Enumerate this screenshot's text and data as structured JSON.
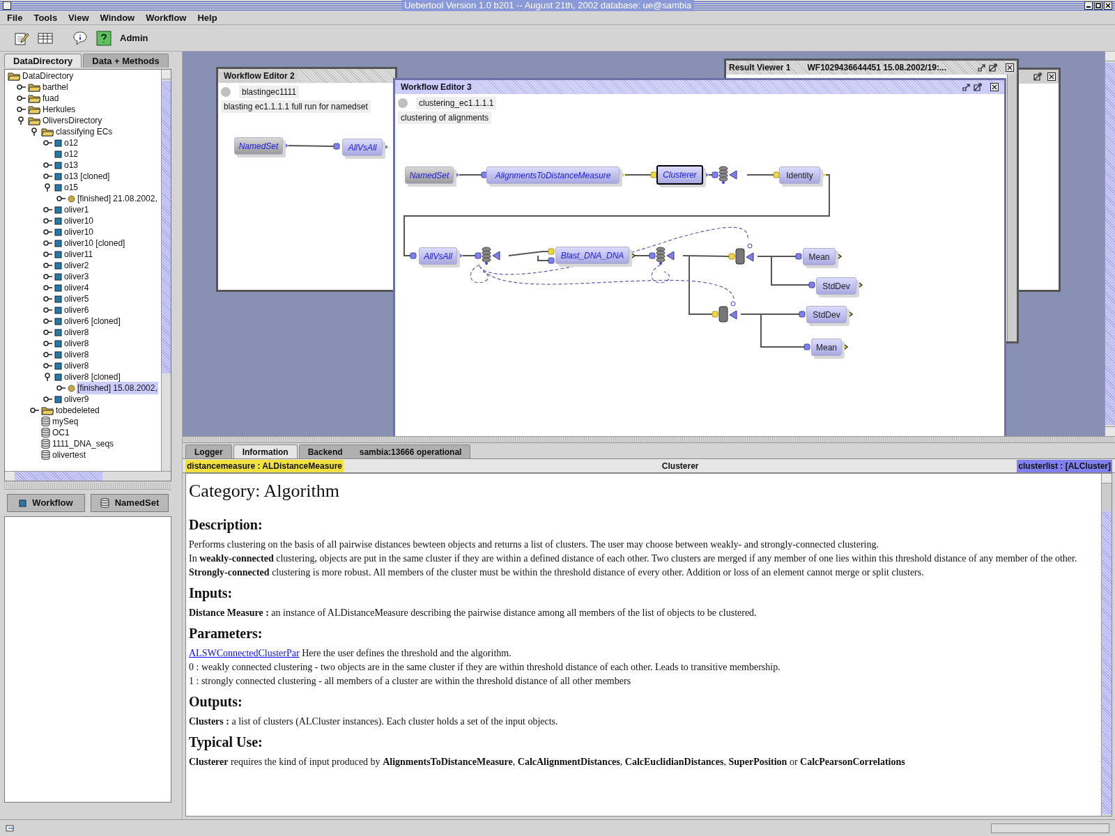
{
  "app": {
    "title": "Uebertool Version 1.0 b201 -- August 21th, 2002  database: ue@sambia",
    "menu": [
      "File",
      "Tools",
      "View",
      "Window",
      "Workflow",
      "Help"
    ],
    "toolbar": {
      "user": "Admin"
    }
  },
  "left_panel": {
    "tabs": [
      {
        "label": "DataDirectory",
        "selected": true
      },
      {
        "label": "Data + Methods",
        "selected": false
      }
    ],
    "tree": [
      {
        "label": "DataDirectory",
        "kind": "folder",
        "selected": false,
        "children": [
          {
            "label": "barthel",
            "kind": "folder",
            "expanded": false,
            "selected": false
          },
          {
            "label": "fuad",
            "kind": "folder",
            "expanded": false,
            "selected": false
          },
          {
            "label": "Herkules",
            "kind": "folder",
            "expanded": false,
            "selected": false
          },
          {
            "label": "OliversDirectory",
            "kind": "folder",
            "expanded": true,
            "selected": false,
            "children": [
              {
                "label": "classifying ECs",
                "kind": "folder",
                "expanded": true,
                "selected": false,
                "children": [
                  {
                    "label": "o12",
                    "kind": "workflow",
                    "expanded": false,
                    "selected": false
                  },
                  {
                    "label": "o12",
                    "kind": "workflow",
                    "selected": false
                  },
                  {
                    "label": "o13",
                    "kind": "workflow",
                    "expanded": false,
                    "selected": false
                  },
                  {
                    "label": "o13 [cloned]",
                    "kind": "workflow",
                    "expanded": false,
                    "selected": false
                  },
                  {
                    "label": "o15",
                    "kind": "workflow",
                    "expanded": true,
                    "selected": false,
                    "children": [
                      {
                        "label": "[finished] 21.08.2002,",
                        "kind": "result",
                        "expanded": false,
                        "selected": false
                      }
                    ]
                  },
                  {
                    "label": "oliver1",
                    "kind": "workflow",
                    "expanded": false,
                    "selected": false
                  },
                  {
                    "label": "oliver10",
                    "kind": "workflow",
                    "expanded": false,
                    "selected": false
                  },
                  {
                    "label": "oliver10",
                    "kind": "workflow",
                    "expanded": false,
                    "selected": false
                  },
                  {
                    "label": "oliver10 [cloned]",
                    "kind": "workflow",
                    "expanded": false,
                    "selected": false
                  },
                  {
                    "label": "oliver11",
                    "kind": "workflow",
                    "expanded": false,
                    "selected": false
                  },
                  {
                    "label": "oliver2",
                    "kind": "workflow",
                    "expanded": false,
                    "selected": false
                  },
                  {
                    "label": "oliver3",
                    "kind": "workflow",
                    "expanded": false,
                    "selected": false
                  },
                  {
                    "label": "oliver4",
                    "kind": "workflow",
                    "expanded": false,
                    "selected": false
                  },
                  {
                    "label": "oliver5",
                    "kind": "workflow",
                    "expanded": false,
                    "selected": false
                  },
                  {
                    "label": "oliver6",
                    "kind": "workflow",
                    "expanded": false,
                    "selected": false
                  },
                  {
                    "label": "oliver6 [cloned]",
                    "kind": "workflow",
                    "expanded": false,
                    "selected": false
                  },
                  {
                    "label": "oliver8",
                    "kind": "workflow",
                    "expanded": false,
                    "selected": false
                  },
                  {
                    "label": "oliver8",
                    "kind": "workflow",
                    "expanded": false,
                    "selected": false
                  },
                  {
                    "label": "oliver8",
                    "kind": "workflow",
                    "expanded": false,
                    "selected": false
                  },
                  {
                    "label": "oliver8",
                    "kind": "workflow",
                    "expanded": false,
                    "selected": false
                  },
                  {
                    "label": "oliver8 [cloned]",
                    "kind": "workflow",
                    "expanded": true,
                    "selected": false,
                    "children": [
                      {
                        "label": "[finished] 15.08.2002,",
                        "kind": "result",
                        "expanded": false,
                        "selected": true
                      }
                    ]
                  },
                  {
                    "label": "oliver9",
                    "kind": "workflow",
                    "expanded": false,
                    "selected": false
                  }
                ]
              },
              {
                "label": "tobedeleted",
                "kind": "folder",
                "expanded": false,
                "selected": false
              },
              {
                "label": "mySeq",
                "kind": "dataset",
                "selected": false
              },
              {
                "label": "OC1",
                "kind": "dataset",
                "selected": false
              },
              {
                "label": "1111_DNA_seqs",
                "kind": "dataset",
                "selected": false
              },
              {
                "label": "olivertest",
                "kind": "dataset",
                "selected": false
              }
            ]
          }
        ]
      }
    ],
    "buttons": [
      {
        "label": "Workflow",
        "kind": "workflow"
      },
      {
        "label": "NamedSet",
        "kind": "dataset"
      }
    ]
  },
  "desktop": {
    "windows": [
      {
        "title": "Workflow Editor 2",
        "active": false,
        "workflow_name": "blastingec1111",
        "description": "blasting ec1.1.1.1 full run for namedset",
        "nodes": [
          {
            "label": "NamedSet",
            "kind": "data",
            "selected": false
          },
          {
            "label": "AllVsAll",
            "kind": "method",
            "selected": false
          }
        ]
      },
      {
        "title": "Result Viewer 1",
        "subtitle": "WF1029436644451 15.08.2002/19:...",
        "active": false
      },
      {
        "title": "Workflow Editor 3",
        "active": true,
        "workflow_name": "clustering_ec1.1.1.1",
        "description": "clustering of alignments",
        "nodes": [
          {
            "label": "NamedSet",
            "kind": "data",
            "selected": false
          },
          {
            "label": "AlignmentsToDistanceMeasure",
            "kind": "method",
            "selected": false
          },
          {
            "label": "Clusterer",
            "kind": "method",
            "selected": true
          },
          {
            "label": "Identity",
            "kind": "statistic",
            "selected": false
          },
          {
            "label": "AllVsAll",
            "kind": "method",
            "selected": false
          },
          {
            "label": "Blast_DNA_DNA",
            "kind": "method",
            "selected": false
          },
          {
            "label": "Mean",
            "kind": "statistic",
            "selected": false
          },
          {
            "label": "StdDev",
            "kind": "statistic",
            "selected": false
          },
          {
            "label": "StdDev",
            "kind": "statistic",
            "selected": false
          },
          {
            "label": "Mean",
            "kind": "statistic",
            "selected": false
          }
        ]
      }
    ]
  },
  "info_panel": {
    "tabs": [
      {
        "label": "Logger",
        "selected": false
      },
      {
        "label": "Information",
        "selected": true
      },
      {
        "label": "Backend",
        "selected": false,
        "status": "sambia:13666 operational"
      }
    ],
    "header": {
      "input": "distancemeasure : ALDistanceMeasure",
      "title": "Clusterer",
      "output": "clusterlist : [ALCluster]"
    },
    "document": {
      "title": "Category: Algorithm",
      "sections": [
        {
          "heading": "Description:",
          "items": [
            {
              "kind": "text",
              "text": "Performs clustering on the basis of all pairwise distances bewteen objects and returns a list of clusters. The user may choose between weakly- and strongly-connected clustering."
            },
            {
              "kind": "text",
              "text": "In **weakly-connected** clustering, objects are put in the same cluster if they are within a defined distance of each other. Two clusters are merged if any member of one lies within this threshold distance of any member of the other."
            },
            {
              "kind": "text",
              "text": "**Strongly-connected** clustering is more robust. All members of the cluster must be within the threshold distance of every other. Addition or loss of an element cannot merge or split clusters."
            }
          ]
        },
        {
          "heading": "Inputs:",
          "items": [
            {
              "kind": "text",
              "text": "**Distance Measure :** an instance of ALDistanceMeasure describing the pairwise distance among all members of the list of objects to be clustered."
            }
          ]
        },
        {
          "heading": "Parameters:",
          "items": [
            {
              "kind": "link",
              "link": "ALSWConnectedClusterPar",
              "text": " Here the user defines the threshold and the algorithm."
            },
            {
              "kind": "text",
              "text": "0 : weakly connected clustering - two objects are in the same cluster if they are within threshold distance of each other. Leads to transitive membership."
            },
            {
              "kind": "text",
              "text": "1 : strongly connected clustering - all members of a cluster are within the threshold distance of all other members"
            }
          ]
        },
        {
          "heading": "Outputs:",
          "items": [
            {
              "kind": "text",
              "text": "**Clusters :** a list of clusters (ALCluster instances). Each cluster holds a set of the input objects."
            }
          ]
        },
        {
          "heading": "Typical Use:",
          "items": [
            {
              "kind": "text",
              "text": "**Clusterer** requires the kind of input produced by **AlignmentsToDistanceMeasure**, **CalcAlignmentDistances**, **CalcEuclidianDistances**, **SuperPosition** or **CalcPearsonCorrelations**"
            }
          ]
        }
      ]
    }
  }
}
